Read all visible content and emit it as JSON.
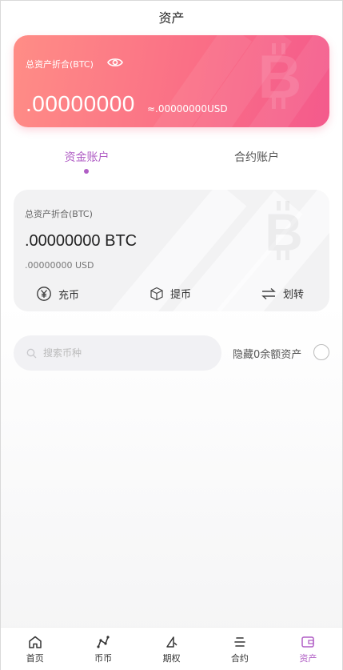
{
  "header": {
    "title": "资产"
  },
  "summary": {
    "label": "总资产折合(BTC)",
    "amount": ".00000000",
    "usd": "≈.00000000USD"
  },
  "tabs": [
    {
      "label": "资金账户",
      "active": true
    },
    {
      "label": "合约账户",
      "active": false
    }
  ],
  "fund_card": {
    "label": "总资产折合(BTC)",
    "amount": ".00000000 BTC",
    "usd": ".00000000 USD",
    "actions": [
      {
        "label": "充币",
        "icon": "yen-coin-icon"
      },
      {
        "label": "提币",
        "icon": "box-icon"
      },
      {
        "label": "划转",
        "icon": "transfer-arrows-icon"
      }
    ]
  },
  "search": {
    "placeholder": "搜索币种",
    "value": ""
  },
  "hide_zero": {
    "label": "隐藏0余额资产",
    "checked": false
  },
  "tabbar": {
    "items": [
      {
        "label": "首页",
        "icon": "home-icon"
      },
      {
        "label": "币币",
        "icon": "spot-icon"
      },
      {
        "label": "期权",
        "icon": "options-icon"
      },
      {
        "label": "合约",
        "icon": "contract-icon"
      },
      {
        "label": "资产",
        "icon": "wallet-icon",
        "active": true
      }
    ]
  },
  "colors": {
    "accent": "#b05ec5",
    "hero_start": "#ff8d86",
    "hero_end": "#f45a8c"
  }
}
